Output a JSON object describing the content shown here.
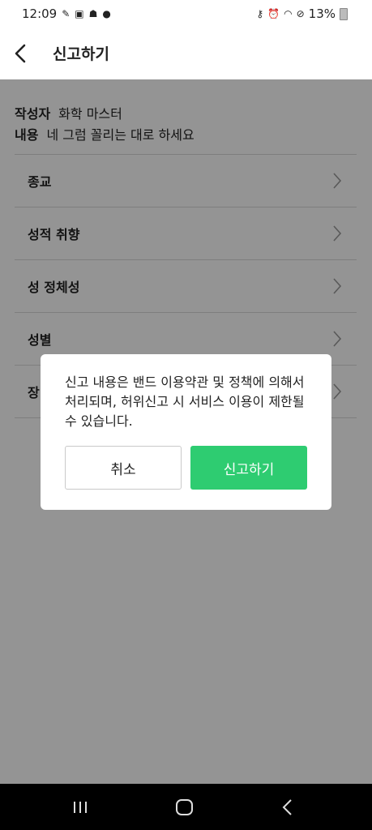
{
  "status_bar": {
    "time": "12:09",
    "left_icons": [
      "notification-icon",
      "image-icon",
      "app-icon",
      "dot-icon"
    ],
    "right_icons": [
      "key-icon",
      "alarm-icon",
      "wifi-icon",
      "do-not-disturb-icon"
    ],
    "battery": "13%"
  },
  "header": {
    "title": "신고하기",
    "back_icon": "chevron-left-icon"
  },
  "meta": {
    "author_label": "작성자",
    "author_value": "화학 마스터",
    "content_label": "내용",
    "content_value": "네 그럼 꼴리는 대로 하세요"
  },
  "reasons": [
    {
      "label": "종교"
    },
    {
      "label": "성적 취향"
    },
    {
      "label": "성 정체성"
    },
    {
      "label": "성별"
    },
    {
      "label": "장"
    }
  ],
  "dialog": {
    "message": "신고 내용은 밴드 이용약관 및 정책에 의해서 처리되며, 허위신고 시 서비스 이용이 제한될 수 있습니다.",
    "cancel_label": "취소",
    "report_label": "신고하기"
  },
  "colors": {
    "accent": "#2ecc71",
    "overlay": "#000000"
  }
}
